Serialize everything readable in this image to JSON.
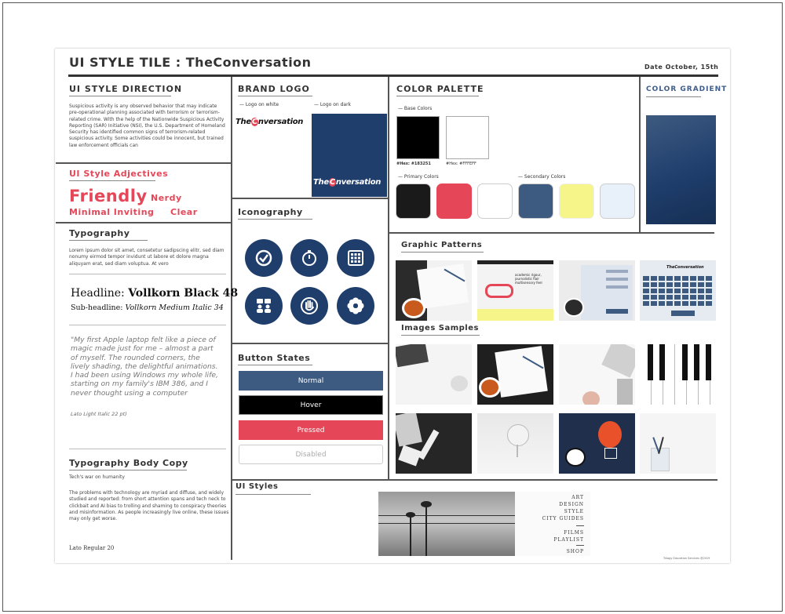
{
  "header": {
    "title": "UI STYLE TILE : TheConversation",
    "date": "Date October, 15th"
  },
  "style_direction": {
    "heading": "UI STYLE DIRECTION",
    "body": "Suspicious activity is any observed behavior that may indicate pre-operational planning associated with terrorism or terrorism-related crime. With the help of the Nationwide Suspicious Activity Reporting (SAR) Initiative (NSI), the U.S. Department of Homeland Security has identified common signs of terrorism-related suspicious activity. Some activities could be innocent, but trained law enforcement officials can"
  },
  "adjectives": {
    "heading": "UI Style Adjectives",
    "friendly": "Friendly",
    "nerdy": "Nerdy",
    "minimal_inviting": "Minimal Inviting",
    "clear": "Clear"
  },
  "typography": {
    "heading": "Typography",
    "lorem": "Lorem ipsum dolor sit amet, consetetur sadipscing elitr, sed diam nonumy eirmod tempor invidunt ut labore et dolore magna aliquyam erat, sed diam voluptua. At vero",
    "headline_label": "Headline:",
    "headline_font": "Vollkorn Black 48",
    "subheadline_label": "Sub-headline:",
    "subheadline_font": "Vollkorn Medium Italic 34",
    "quote": "\"My first Apple laptop felt like a piece of magic made just for me – almost a part of myself. The rounded corners, the lively shading, the delightful animations. I had been using Windows my whole life, starting on my family's IBM 386, and I never thought using a computer",
    "quote_font": "Lato Light Italic 22 pt)"
  },
  "body_copy": {
    "heading": "Typography Body Copy",
    "subtitle": "Tech's war on humanity",
    "paragraph": "The problems with technology are myriad and diffuse, and widely studied and reported: from short attention spans and tech neck to clickbait and AI bias to trolling and shaming to conspiracy theories and misinformation. As people increasingly live online, these issues may only get worse.",
    "font_label": "Lato Regular 20"
  },
  "brand_logo": {
    "heading": "BRAND LOGO",
    "on_white": "Logo on white",
    "on_dark": "Logo on dark",
    "logo_text_the": "The",
    "logo_text_c": "C",
    "logo_text_rest": "nversation"
  },
  "iconography": {
    "heading": "Iconography",
    "icons": [
      "check-badge-icon",
      "stopwatch-icon",
      "grid-icon",
      "team-icon",
      "hand-icon",
      "flower-icon"
    ]
  },
  "button_states": {
    "heading": "Button States",
    "normal": "Normal",
    "hover": "Hover",
    "pressed": "Pressed",
    "disabled": "Disabled"
  },
  "color_palette": {
    "heading": "COLOR PALETTE",
    "base_label": "Base Colors",
    "base_hex_1": "#Hex: #183251",
    "base_hex_2": "#Hex: #FFFEFF",
    "primary_label": "Primary Colors",
    "secondary_label": "Secondary Colors",
    "colors": {
      "black": "#000000",
      "white": "#ffffff",
      "navy": "#1f3e6c",
      "red": "#e64758",
      "primary_dark": "#1a1a1a",
      "primary_light": "#ffffff",
      "secondary_navy": "#3d5a80",
      "secondary_yellow": "#f5f58a",
      "secondary_light": "#e8f0fa"
    }
  },
  "color_gradient": {
    "heading": "COLOR GRADIENT"
  },
  "graphic_patterns": {
    "heading": "Graphic Patterns",
    "card_brand": "TheConversation",
    "card_text": "academic rigour, journalistic flair multisensory feel"
  },
  "images_samples": {
    "heading": "Images Samples"
  },
  "ui_styles": {
    "heading": "UI Styles",
    "menu": [
      "ART",
      "DESIGN",
      "STYLE",
      "CITY GUIDES",
      "FILMS",
      "PLAYLIST",
      "SHOP"
    ]
  },
  "footer": {
    "credit": "Trilogy Education Services @2019"
  }
}
